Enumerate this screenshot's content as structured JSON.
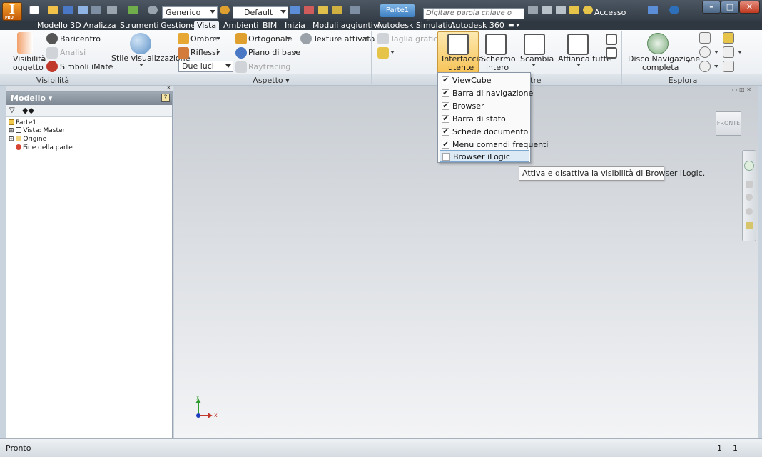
{
  "title_bar": {
    "app_button": "I",
    "app_edition": "PRO",
    "material_combo": "Generico",
    "appearance_combo": "Default",
    "document_title": "Parte1",
    "search_placeholder": "Digitare parola chiave o frase",
    "login_label": "Accesso"
  },
  "tabs": [
    "Modello 3D",
    "Analizza",
    "Strumenti",
    "Gestione",
    "Vista",
    "Ambienti",
    "BIM",
    "Inizia",
    "Moduli aggiuntivi",
    "Autodesk Simulation",
    "Autodesk 360"
  ],
  "active_tab": "Vista",
  "ribbon": {
    "visibility": {
      "panel": "Visibilità",
      "object_visibility_1": "Visibilità",
      "object_visibility_2": "oggetto",
      "baricentro": "Baricentro",
      "analisi": "Analisi",
      "simboli_imate": "Simboli iMate"
    },
    "aspect": {
      "panel": "Aspetto",
      "stile": "Stile visualizzazione",
      "ombre": "Ombre",
      "riflessi": "Riflessi",
      "lighting_combo": "Due luci",
      "ortogonale": "Ortogonale",
      "piano_base": "Piano di base",
      "raytracing": "Raytracing",
      "texture": "Texture attivata",
      "taglia_grafica": "Taglia grafica"
    },
    "windows": {
      "panel_partial": "stre",
      "interfaccia_1": "Interfaccia",
      "interfaccia_2": "utente",
      "schermo_1": "Schermo",
      "schermo_2": "intero",
      "scambia": "Scambia",
      "affianca": "Affianca tutte"
    },
    "navigate": {
      "panel": "Esplora",
      "disco_1": "Disco Navigazione",
      "disco_2": "completa"
    }
  },
  "browser": {
    "title": "Modello",
    "tree": [
      {
        "label": "Parte1",
        "icon": "part-icon"
      },
      {
        "label": "Vista: Master",
        "icon": "view-icon"
      },
      {
        "label": "Origine",
        "icon": "folder-icon"
      },
      {
        "label": "Fine della parte",
        "icon": "end-of-part-icon"
      }
    ]
  },
  "viewport": {
    "viewcube_face": "FRONTE",
    "axis_x": "x",
    "axis_y": "y"
  },
  "ui_menu": {
    "items": [
      {
        "label": "ViewCube",
        "checked": true
      },
      {
        "label": "Barra di navigazione",
        "checked": true
      },
      {
        "label": "Browser",
        "checked": true
      },
      {
        "label": "Barra di stato",
        "checked": true
      },
      {
        "label": "Schede documento",
        "checked": true
      },
      {
        "label": "Menu comandi frequenti",
        "checked": true
      },
      {
        "label": "Browser iLogic",
        "checked": false
      }
    ],
    "tooltip": "Attiva e disattiva la visibilità di Browser iLogic."
  },
  "status": {
    "text": "Pronto",
    "count_1": "1",
    "count_2": "1"
  }
}
